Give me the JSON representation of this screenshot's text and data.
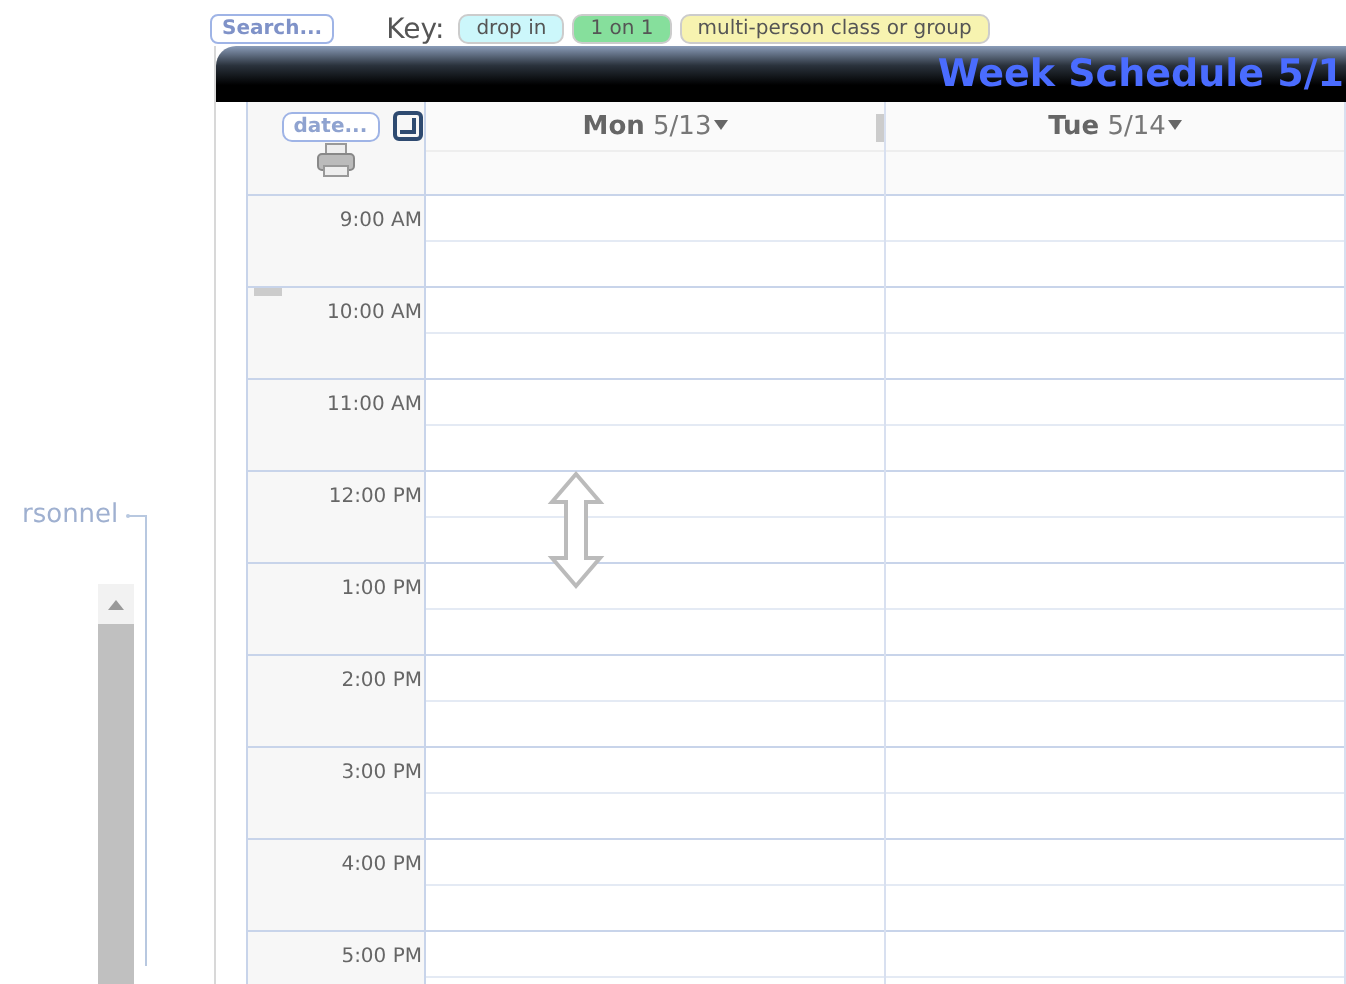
{
  "search_button": "Search...",
  "key": {
    "label": "Key:",
    "items": [
      {
        "label": "drop in",
        "color": "#ccf7fb"
      },
      {
        "label": "1 on 1",
        "color": "#86df9c"
      },
      {
        "label": "multi-person class or group",
        "color": "#f7f3b0"
      }
    ]
  },
  "sidebar": {
    "label": "rsonnel"
  },
  "schedule": {
    "title": "Week Schedule 5/1",
    "date_button": "date...",
    "days": [
      {
        "weekday": "Mon",
        "date": "5/13"
      },
      {
        "weekday": "Tue",
        "date": "5/14"
      }
    ],
    "times": [
      "9:00 AM",
      "10:00 AM",
      "11:00 AM",
      "12:00 PM",
      "1:00 PM",
      "2:00 PM",
      "3:00 PM",
      "4:00 PM",
      "5:00 PM"
    ]
  }
}
